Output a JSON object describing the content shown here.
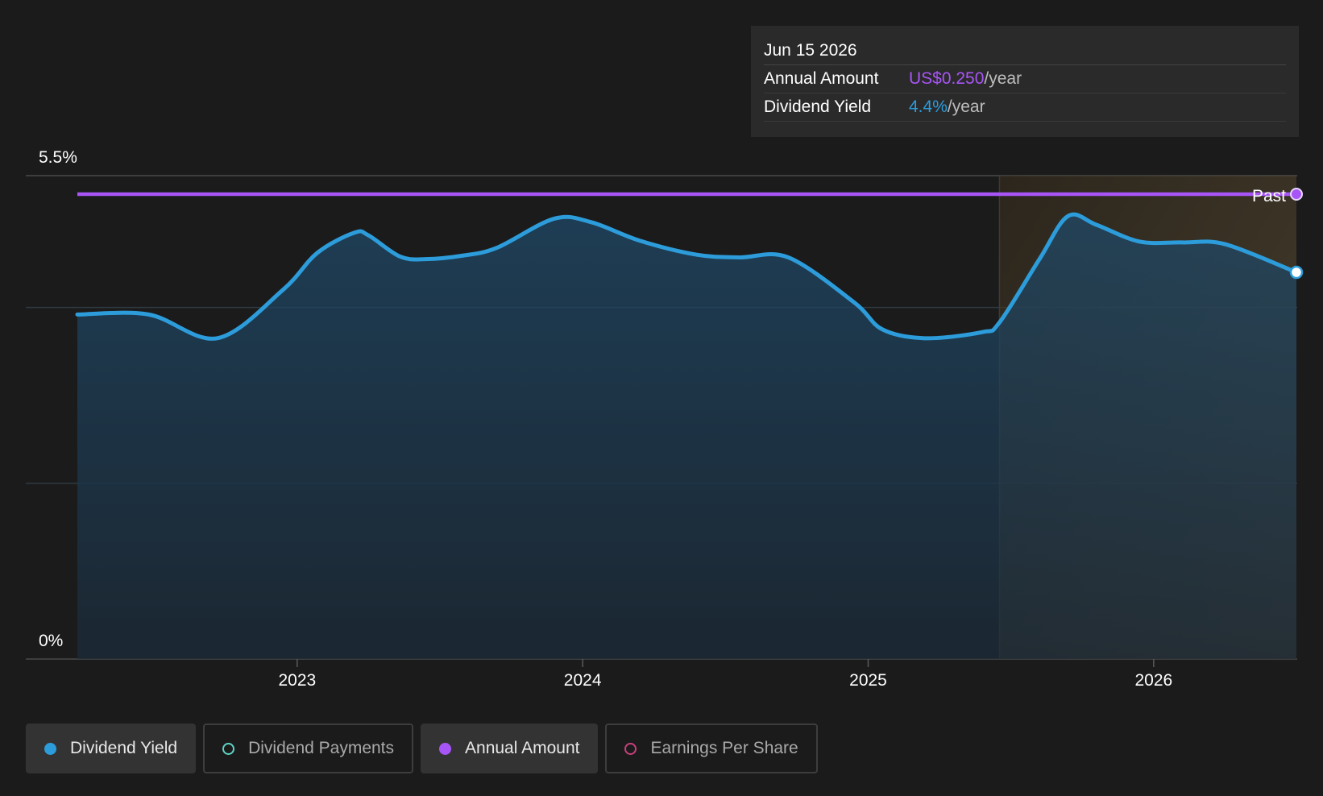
{
  "tooltip": {
    "date": "Jun 15 2026",
    "rows": [
      {
        "label": "Annual Amount",
        "value": "US$0.250",
        "unit": "/year",
        "color": "#a855f7"
      },
      {
        "label": "Dividend Yield",
        "value": "4.4%",
        "unit": "/year",
        "color": "#2d9cdb"
      }
    ]
  },
  "legend": [
    {
      "label": "Dividend Yield",
      "color": "#2d9cdb",
      "filled": true,
      "active": true
    },
    {
      "label": "Dividend Payments",
      "color": "#5fd3c5",
      "filled": false,
      "active": false
    },
    {
      "label": "Annual Amount",
      "color": "#a855f7",
      "filled": true,
      "active": true
    },
    {
      "label": "Earnings Per Share",
      "color": "#c8407a",
      "filled": false,
      "active": false
    }
  ],
  "chart_data": {
    "type": "area",
    "x_tick_labels": [
      "2023",
      "2024",
      "2025",
      "2026"
    ],
    "y_tick_labels": [
      "5.5%",
      "0%"
    ],
    "ylim": [
      0,
      5.5
    ],
    "xlim": [
      2022.23,
      2026.5
    ],
    "past_label": "Past",
    "forecast_start": 2025.46,
    "grid": true,
    "series": [
      {
        "name": "Dividend Yield",
        "unit": "%",
        "color": "#2d9cdb",
        "x": [
          2022.23,
          2022.48,
          2022.72,
          2022.95,
          2023.07,
          2023.2,
          2023.25,
          2023.36,
          2023.45,
          2023.58,
          2023.7,
          2023.9,
          2024.03,
          2024.2,
          2024.4,
          2024.55,
          2024.72,
          2024.95,
          2025.05,
          2025.2,
          2025.4,
          2025.46,
          2025.6,
          2025.7,
          2025.8,
          2025.95,
          2026.1,
          2026.25,
          2026.5
        ],
        "y": [
          3.92,
          3.92,
          3.65,
          4.2,
          4.62,
          4.85,
          4.82,
          4.58,
          4.55,
          4.59,
          4.68,
          5.01,
          4.97,
          4.76,
          4.6,
          4.57,
          4.57,
          4.06,
          3.75,
          3.65,
          3.72,
          3.83,
          4.55,
          5.04,
          4.94,
          4.75,
          4.74,
          4.72,
          4.4
        ]
      },
      {
        "name": "Annual Amount",
        "unit": "US$",
        "color": "#a855f7",
        "x": [
          2022.23,
          2026.5
        ],
        "y": [
          0.25,
          0.25
        ]
      }
    ]
  }
}
